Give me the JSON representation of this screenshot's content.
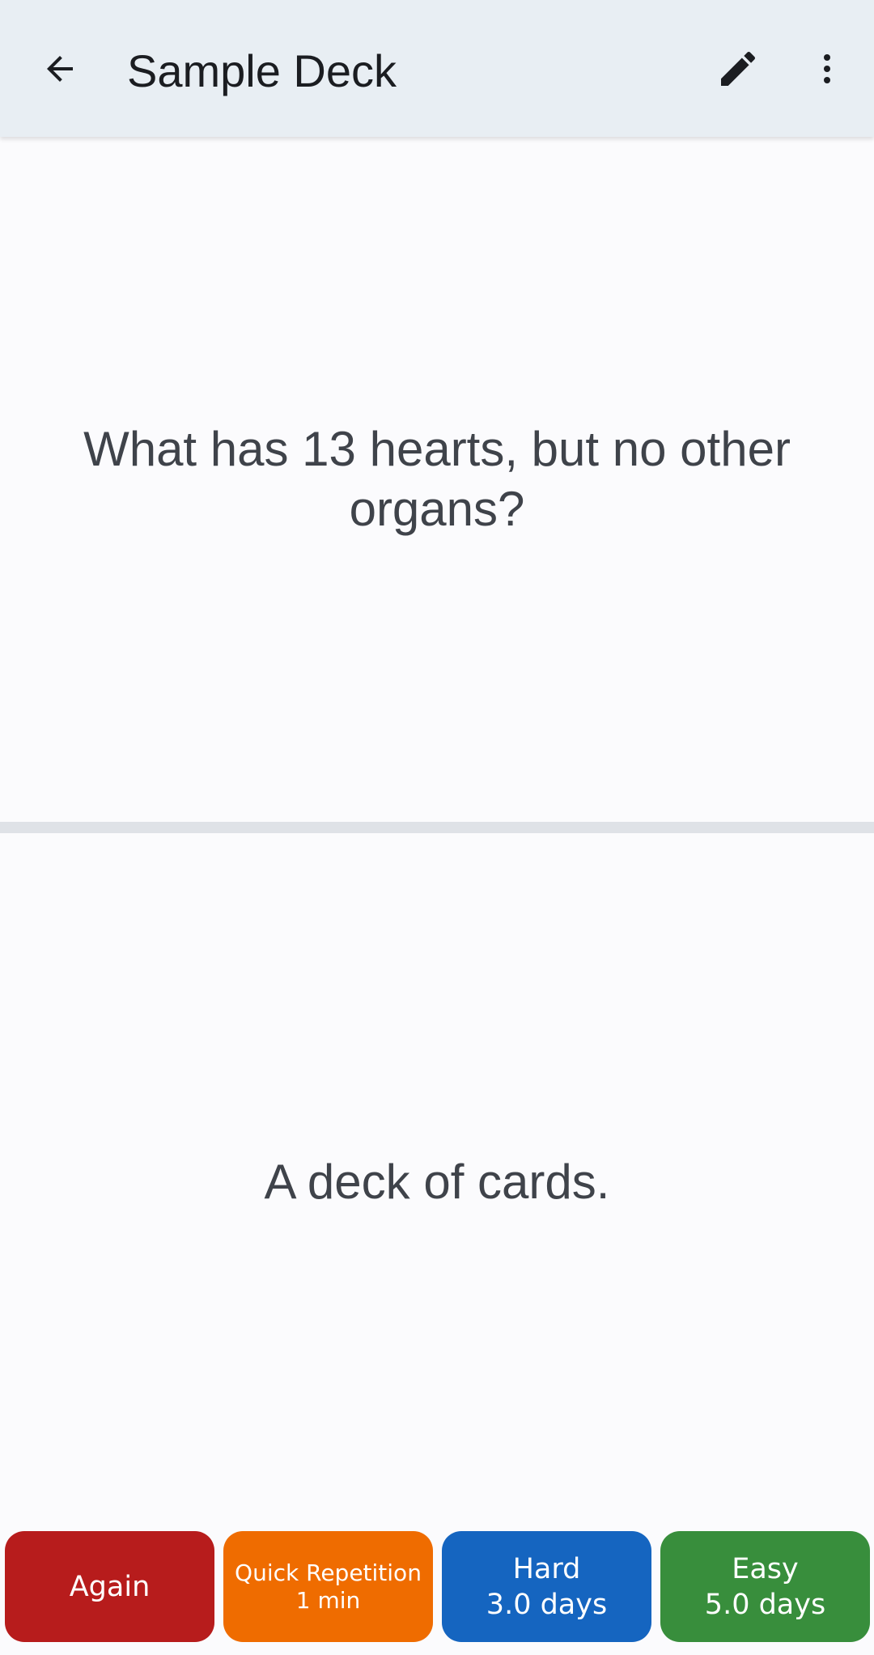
{
  "appbar": {
    "title": "Sample Deck",
    "icons": {
      "back": "arrow-back-icon",
      "edit": "pencil-icon",
      "more": "more-vert-icon"
    },
    "color": "#e8eef3"
  },
  "card": {
    "question": "What has 13 hearts, but no other organs?",
    "answer": "A deck of cards."
  },
  "rating_buttons": [
    {
      "label": "Again",
      "interval": "",
      "color": "#b71c1c"
    },
    {
      "label": "Quick Repetition",
      "interval": "1 min",
      "color": "#ef6c00"
    },
    {
      "label": "Hard",
      "interval": "3.0 days",
      "color": "#1565c0"
    },
    {
      "label": "Easy",
      "interval": "5.0 days",
      "color": "#388e3c"
    }
  ]
}
